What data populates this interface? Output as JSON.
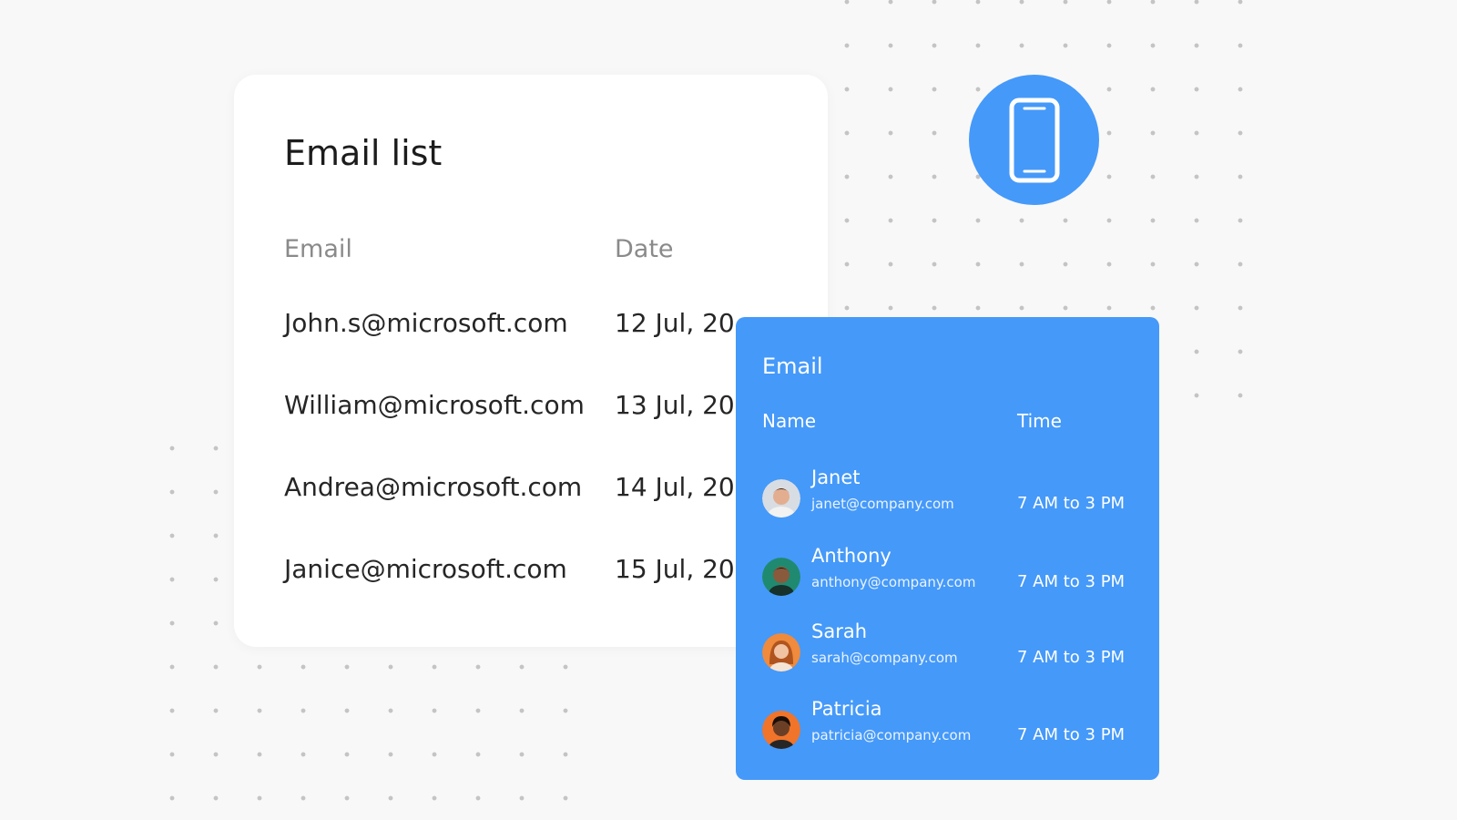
{
  "email_list": {
    "title": "Email list",
    "columns": {
      "email": "Email",
      "date": "Date"
    },
    "rows": [
      {
        "email": "John.s@microsoft.com",
        "date": "12 Jul, 20"
      },
      {
        "email": "William@microsoft.com",
        "date": "13 Jul, 20"
      },
      {
        "email": "Andrea@microsoft.com",
        "date": "14 Jul, 20"
      },
      {
        "email": "Janice@microsoft.com",
        "date": "15 Jul, 20"
      }
    ]
  },
  "device_badge": {
    "icon": "smartphone-icon"
  },
  "email_panel": {
    "title": "Email",
    "columns": {
      "name": "Name",
      "time": "Time"
    },
    "rows": [
      {
        "name": "Janet",
        "email": "janet@company.com",
        "time": "7 AM to 3 PM"
      },
      {
        "name": "Anthony",
        "email": "anthony@company.com",
        "time": "7 AM to 3 PM"
      },
      {
        "name": "Sarah",
        "email": "sarah@company.com",
        "time": "7 AM to 3 PM"
      },
      {
        "name": "Patricia",
        "email": "patricia@company.com",
        "time": "7 AM to 3 PM"
      }
    ]
  },
  "colors": {
    "accent": "#4599f9",
    "background": "#f8f8f8",
    "card": "#ffffff"
  }
}
